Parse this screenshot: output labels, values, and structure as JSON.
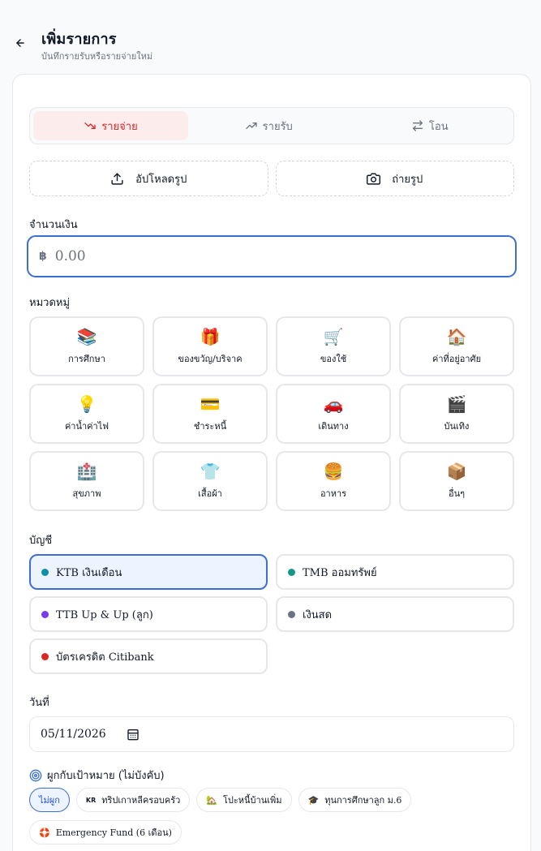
{
  "header": {
    "title": "เพิ่มรายการ",
    "subtitle": "บันทึกรายรับหรือรายจ่ายใหม่"
  },
  "type_tabs": [
    {
      "label": "รายจ่าย",
      "icon": "trending-down-icon",
      "active": true
    },
    {
      "label": "รายรับ",
      "icon": "trending-up-icon",
      "active": false
    },
    {
      "label": "โอน",
      "icon": "arrows-swap-icon",
      "active": false
    }
  ],
  "upload": {
    "upload_label": "อัปโหลดรูป",
    "camera_label": "ถ่ายรูป"
  },
  "amount": {
    "label": "จำนวนเงิน",
    "currency": "฿",
    "placeholder": "0.00"
  },
  "category": {
    "label": "หมวดหมู่",
    "items": [
      {
        "name": "การศึกษา",
        "emoji": "📚"
      },
      {
        "name": "ของขวัญ/บริจาค",
        "emoji": "🎁"
      },
      {
        "name": "ของใช้",
        "emoji": "🛒"
      },
      {
        "name": "ค่าที่อยู่อาศัย",
        "emoji": "🏠"
      },
      {
        "name": "ค่าน้ำค่าไฟ",
        "emoji": "💡"
      },
      {
        "name": "ชำระหนี้",
        "emoji": "💳"
      },
      {
        "name": "เดินทาง",
        "emoji": "🚗"
      },
      {
        "name": "บันเทิง",
        "emoji": "🎬"
      },
      {
        "name": "สุขภาพ",
        "emoji": "🏥"
      },
      {
        "name": "เสื้อผ้า",
        "emoji": "👕"
      },
      {
        "name": "อาหาร",
        "emoji": "🍔"
      },
      {
        "name": "อื่นๆ",
        "emoji": "📦"
      }
    ]
  },
  "account": {
    "label": "บัญชี",
    "items": [
      {
        "name": "KTB เงินเดือน",
        "color": "#0e8fa8",
        "active": true
      },
      {
        "name": "TMB ออมทรัพย์",
        "color": "#14968a",
        "active": false
      },
      {
        "name": "TTB Up & Up (ลูก)",
        "color": "#7c3aed",
        "active": false
      },
      {
        "name": "เงินสด",
        "color": "#6b7280",
        "active": false
      },
      {
        "name": "บัตรเครดิต Citibank",
        "color": "#dc2626",
        "active": false
      }
    ]
  },
  "date": {
    "label": "วันที่",
    "value": "05/11/2026"
  },
  "goal": {
    "label": "ผูกกับเป้าหมาย (ไม่บังคับ)",
    "chips": [
      {
        "label": "ไม่ผูก",
        "icon": "",
        "active": true
      },
      {
        "label": "ทริปเกาหลีครอบครัว",
        "icon": "KR",
        "active": false
      },
      {
        "label": "โปะหนี้บ้านเพิ่ม",
        "icon": "🏡",
        "active": false
      },
      {
        "label": "ทุนการศึกษาลูก ม.6",
        "icon": "🎓",
        "active": false
      },
      {
        "label": "Emergency Fund (6 เดือน)",
        "icon": "🛟",
        "active": false
      }
    ]
  }
}
